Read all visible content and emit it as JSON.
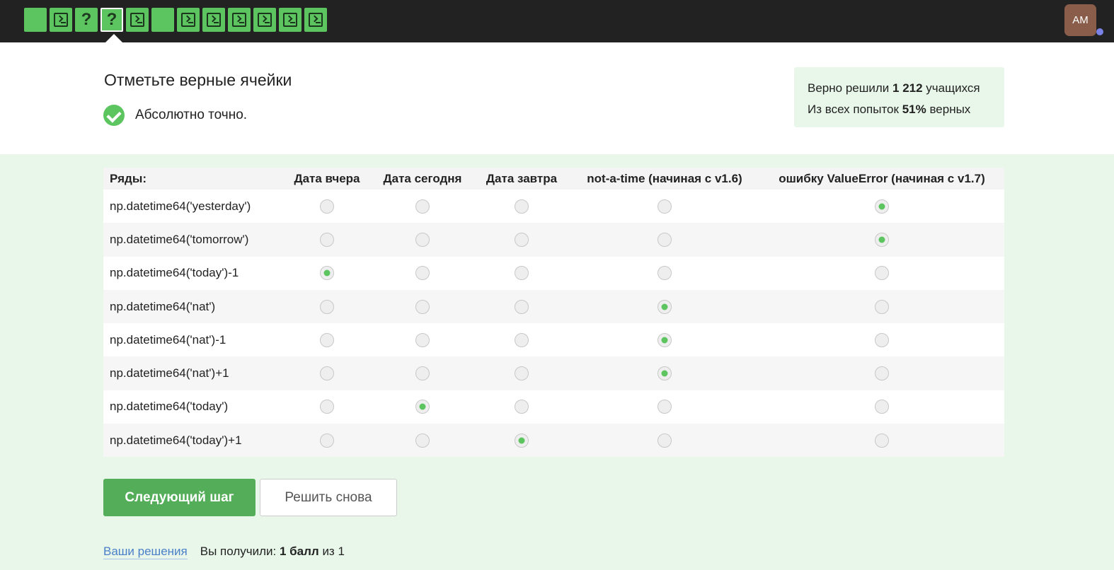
{
  "steps": [
    {
      "type": "blank"
    },
    {
      "type": "terminal"
    },
    {
      "type": "question",
      "label": "?"
    },
    {
      "type": "question",
      "label": "?",
      "active": true
    },
    {
      "type": "terminal"
    },
    {
      "type": "blank"
    },
    {
      "type": "terminal"
    },
    {
      "type": "terminal"
    },
    {
      "type": "terminal"
    },
    {
      "type": "terminal"
    },
    {
      "type": "terminal"
    },
    {
      "type": "terminal"
    }
  ],
  "user": {
    "initials": "AM"
  },
  "task": {
    "title": "Отметьте верные ячейки",
    "status": "Абсолютно точно."
  },
  "stats": {
    "solved_prefix": "Верно решили",
    "solved_count": "1 212",
    "solved_suffix": "учащихся",
    "attempts_prefix": "Из всех попыток",
    "attempts_percent": "51%",
    "attempts_suffix": "верных"
  },
  "table": {
    "row_header": "Ряды:",
    "columns": [
      "Дата вчера",
      "Дата сегодня",
      "Дата завтра",
      "not-a-time (начиная с v1.6)",
      "ошибку ValueError (начиная с v1.7)"
    ],
    "rows": [
      {
        "label": "np.datetime64('yesterday')",
        "selected": 4
      },
      {
        "label": "np.datetime64('tomorrow')",
        "selected": 4
      },
      {
        "label": "np.datetime64('today')-1",
        "selected": 0
      },
      {
        "label": "np.datetime64('nat')",
        "selected": 3
      },
      {
        "label": "np.datetime64('nat')-1",
        "selected": 3
      },
      {
        "label": "np.datetime64('nat')+1",
        "selected": 3
      },
      {
        "label": "np.datetime64('today')",
        "selected": 1
      },
      {
        "label": "np.datetime64('today')+1",
        "selected": 2
      }
    ]
  },
  "buttons": {
    "next": "Следующий шаг",
    "again": "Решить снова"
  },
  "footer": {
    "solutions_link": "Ваши решения",
    "score_prefix": "Вы получили:",
    "score_value": "1 балл",
    "score_middle": "из",
    "score_total": "1"
  },
  "colors": {
    "accent_green": "#5cc560",
    "button_green": "#54ad58",
    "page_bg": "#e8f7e9",
    "topbar_bg": "#222222",
    "link": "#4a7fc9",
    "avatar_bg": "#8a5d4a"
  }
}
